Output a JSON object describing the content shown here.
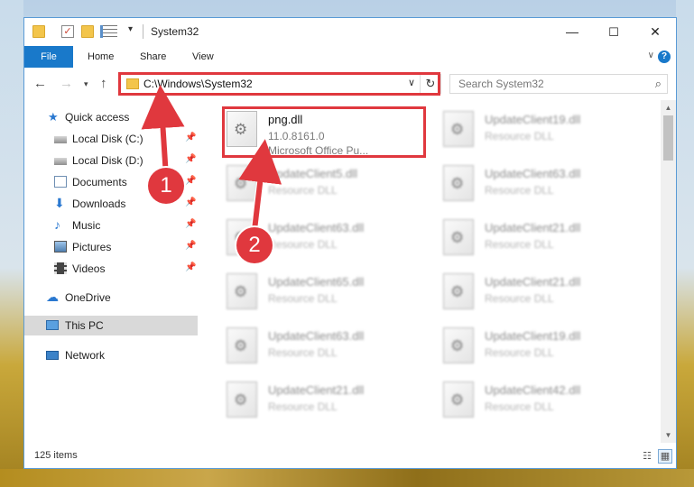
{
  "window": {
    "title": "System32",
    "controls": {
      "minimize": "—",
      "maximize": "☐",
      "close": "✕"
    }
  },
  "ribbon": {
    "tabs": [
      "File",
      "Home",
      "Share",
      "View"
    ],
    "expand_icon": "∨",
    "help_icon": "?"
  },
  "address": {
    "path": "C:\\Windows\\System32",
    "search_placeholder": "Search System32"
  },
  "nav": {
    "items": [
      {
        "label": "Quick access",
        "icon": "star-icon"
      },
      {
        "label": "Local Disk (C:)",
        "icon": "drive-icon",
        "pinned": true
      },
      {
        "label": "Local Disk (D:)",
        "icon": "drive-icon",
        "pinned": true
      },
      {
        "label": "Documents",
        "icon": "documents-icon",
        "pinned": true
      },
      {
        "label": "Downloads",
        "icon": "download-icon",
        "pinned": true
      },
      {
        "label": "Music",
        "icon": "music-icon",
        "pinned": true
      },
      {
        "label": "Pictures",
        "icon": "pictures-icon",
        "pinned": true
      },
      {
        "label": "Videos",
        "icon": "videos-icon",
        "pinned": true
      },
      {
        "label": "OneDrive",
        "icon": "cloud-icon"
      },
      {
        "label": "This PC",
        "icon": "pc-icon",
        "selected": true
      },
      {
        "label": "Network",
        "icon": "network-icon"
      }
    ]
  },
  "files": {
    "highlighted": {
      "name": "png.dll",
      "version": "11.0.8161.0",
      "company": "Microsoft Office Pu..."
    },
    "blurred": [
      {
        "name": "UpdateClient19.dll",
        "type": "Resource DLL"
      },
      {
        "name": "UpdateClient5.dll",
        "type": "Resource DLL"
      },
      {
        "name": "UpdateClient63.dll",
        "type": "Resource DLL"
      },
      {
        "name": "UpdateClient63.dll",
        "type": "Resource DLL"
      },
      {
        "name": "UpdateClient21.dll",
        "type": "Resource DLL"
      },
      {
        "name": "UpdateClient65.dll",
        "type": "Resource DLL"
      },
      {
        "name": "UpdateClient21.dll",
        "type": "Resource DLL"
      },
      {
        "name": "UpdateClient63.dll",
        "type": "Resource DLL"
      },
      {
        "name": "UpdateClient19.dll",
        "type": "Resource DLL"
      },
      {
        "name": "UpdateClient21.dll",
        "type": "Resource DLL"
      },
      {
        "name": "UpdateClient42.dll",
        "type": "Resource DLL"
      }
    ]
  },
  "status": {
    "item_count": "125 items"
  },
  "annotations": {
    "step1": "1",
    "step2": "2",
    "color": "#e0383e"
  }
}
